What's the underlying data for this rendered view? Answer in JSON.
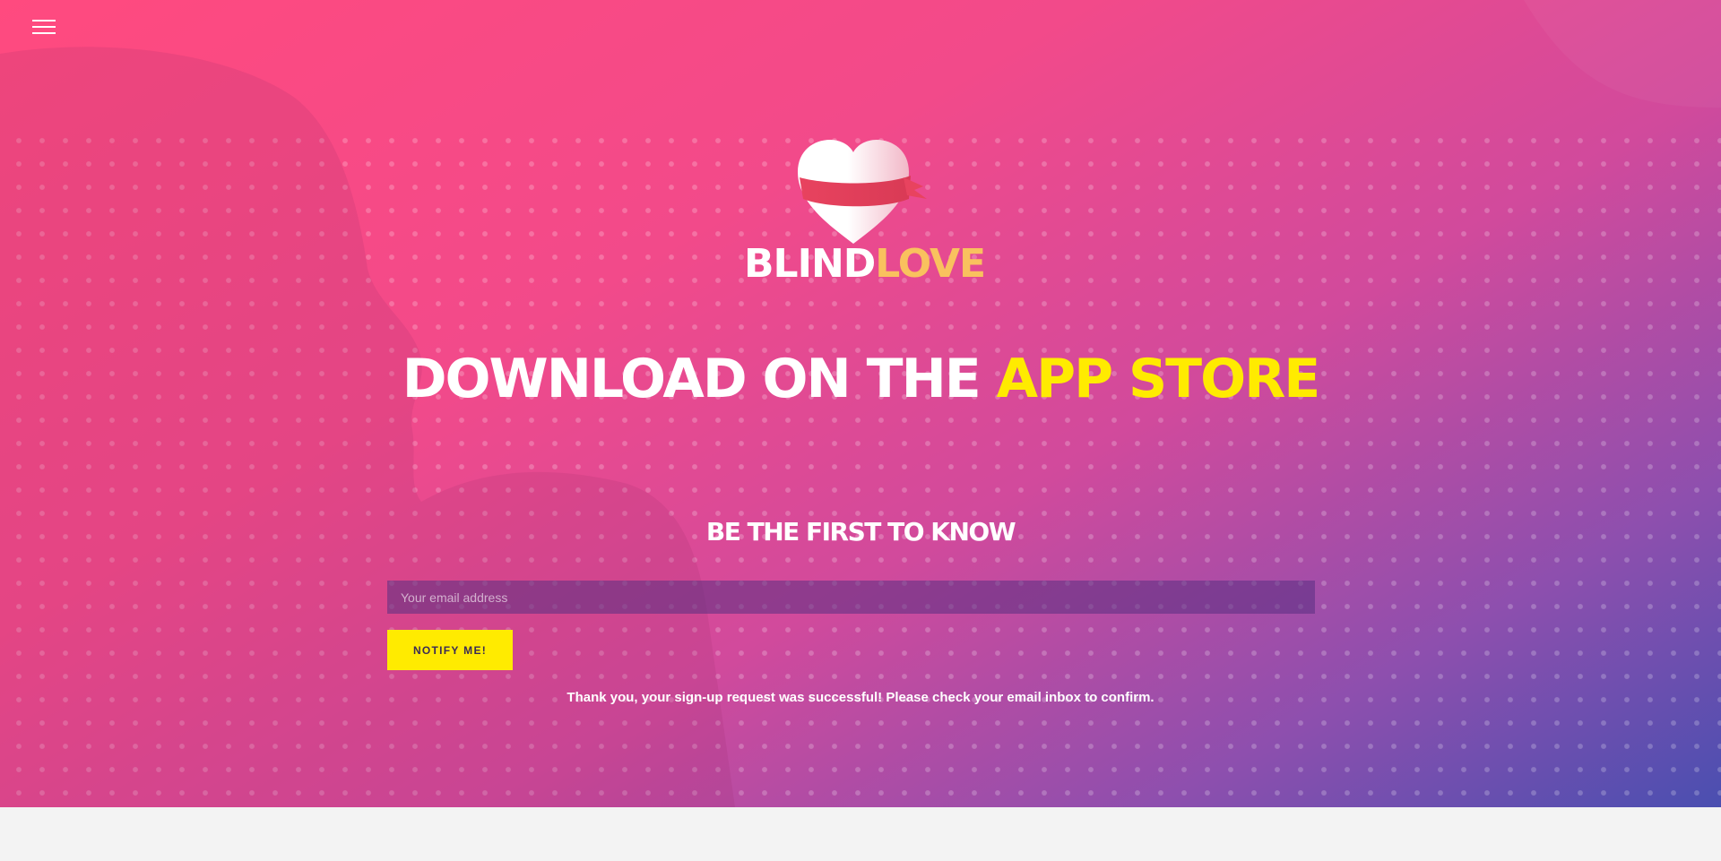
{
  "nav": {
    "menu_icon": "hamburger-menu-icon"
  },
  "logo": {
    "icon": "heart-ribbon-icon",
    "word_part1": "BLIND",
    "word_part2": "LOVE"
  },
  "hero": {
    "headline_part1": "DOWNLOAD ON THE ",
    "headline_accent": "APP STORE",
    "subheadline": "BE THE FIRST TO KNOW"
  },
  "signup": {
    "email_placeholder": "Your email address",
    "email_value": "",
    "button_label": "NOTIFY ME!",
    "success_message": "Thank you, your sign-up request was successful! Please check your email inbox to confirm."
  },
  "colors": {
    "accent_yellow": "#ffeb00",
    "logo_gold": "#f9c15e",
    "gradient_start": "#ff4a7f",
    "gradient_end": "#4a4fb0",
    "footer_background": "#f3f3f3"
  }
}
